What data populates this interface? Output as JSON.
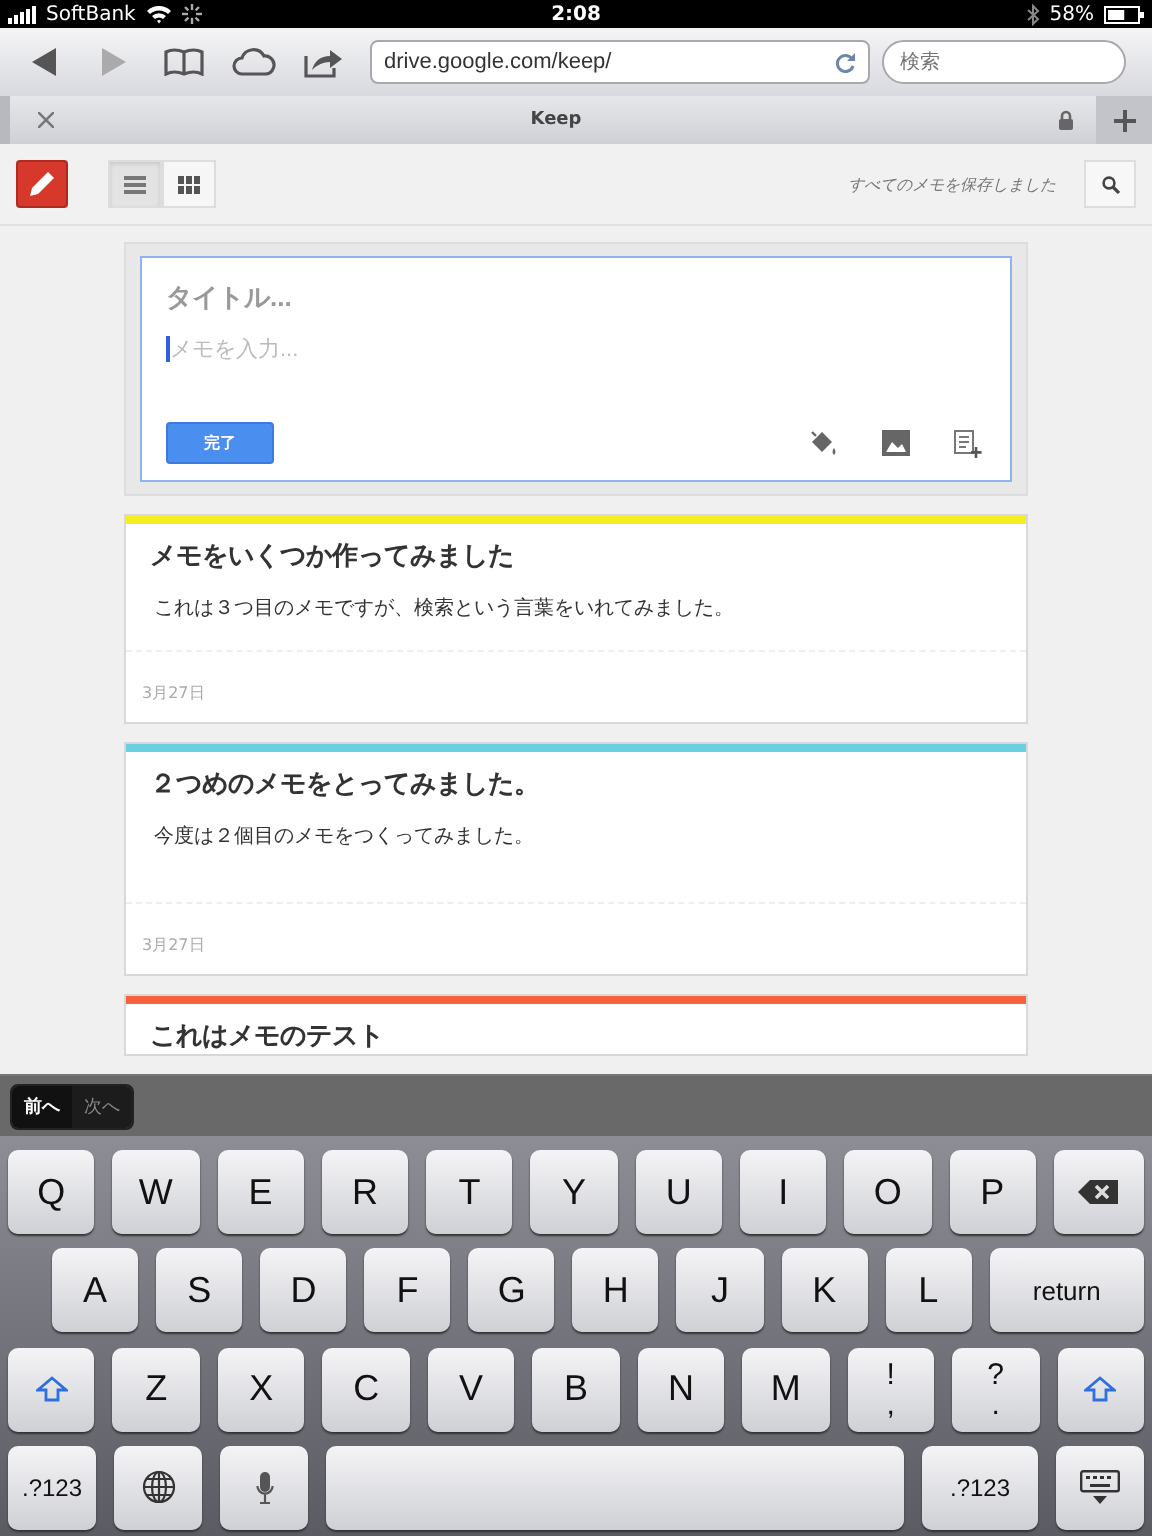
{
  "status_bar": {
    "carrier": "SoftBank",
    "time": "2:08",
    "battery": "58%"
  },
  "browser": {
    "url": "drive.google.com/keep/",
    "search": {
      "placeholder": "検索"
    },
    "forward_disabled": true,
    "tab_title": "Keep"
  },
  "toolbar": {
    "views": [
      {
        "kind": "list",
        "selected": true
      },
      {
        "kind": "grid",
        "selected": false
      }
    ],
    "status": "すべてのメモを保存しました"
  },
  "composer": {
    "title": {
      "placeholder": "タイトル..."
    },
    "body": {
      "placeholder": "メモを入力..."
    },
    "done": "完了"
  },
  "notes": [
    {
      "title": "メモをいくつか作ってみました",
      "body": "これは３つ目のメモですが、検索という言葉をいれてみました。",
      "date": "3月27日",
      "color": "#f2ee1f"
    },
    {
      "title": "２つめのメモをとってみました。",
      "body": "今度は２個目のメモをつくってみました。",
      "date": "3月27日",
      "color": "#6acfe0"
    },
    {
      "title": "これはメモのテスト",
      "color": "#f6603c"
    }
  ],
  "form_nav": [
    {
      "label": "前へ",
      "disabled": false
    },
    {
      "label": "次へ",
      "disabled": true
    }
  ],
  "keyboard": {
    "rows": [
      {
        "keys": [
          {
            "kind": "letter",
            "label": "Q"
          },
          {
            "kind": "letter",
            "label": "W"
          },
          {
            "kind": "letter",
            "label": "E"
          },
          {
            "kind": "letter",
            "label": "R"
          },
          {
            "kind": "letter",
            "label": "T"
          },
          {
            "kind": "letter",
            "label": "Y"
          },
          {
            "kind": "letter",
            "label": "U"
          },
          {
            "kind": "letter",
            "label": "I"
          },
          {
            "kind": "letter",
            "label": "O"
          },
          {
            "kind": "letter",
            "label": "P"
          },
          {
            "kind": "backspace"
          }
        ]
      },
      {
        "keys": [
          {
            "kind": "letter",
            "label": "A"
          },
          {
            "kind": "letter",
            "label": "S"
          },
          {
            "kind": "letter",
            "label": "D"
          },
          {
            "kind": "letter",
            "label": "F"
          },
          {
            "kind": "letter",
            "label": "G"
          },
          {
            "kind": "letter",
            "label": "H"
          },
          {
            "kind": "letter",
            "label": "J"
          },
          {
            "kind": "letter",
            "label": "K"
          },
          {
            "kind": "letter",
            "label": "L"
          },
          {
            "kind": "return",
            "label": "return"
          }
        ]
      },
      {
        "keys": [
          {
            "kind": "shift"
          },
          {
            "kind": "letter",
            "label": "Z"
          },
          {
            "kind": "letter",
            "label": "X"
          },
          {
            "kind": "letter",
            "label": "C"
          },
          {
            "kind": "letter",
            "label": "V"
          },
          {
            "kind": "letter",
            "label": "B"
          },
          {
            "kind": "letter",
            "label": "N"
          },
          {
            "kind": "letter",
            "label": "M"
          },
          {
            "kind": "punct",
            "label": "!",
            "label2": ","
          },
          {
            "kind": "punct",
            "label": "?",
            "label2": "."
          },
          {
            "kind": "shift"
          }
        ]
      },
      {
        "keys": [
          {
            "kind": "mode",
            "label": ".?123"
          },
          {
            "kind": "globe"
          },
          {
            "kind": "mic"
          },
          {
            "kind": "space"
          },
          {
            "kind": "mode",
            "label": ".?123"
          },
          {
            "kind": "hide"
          }
        ]
      }
    ]
  }
}
